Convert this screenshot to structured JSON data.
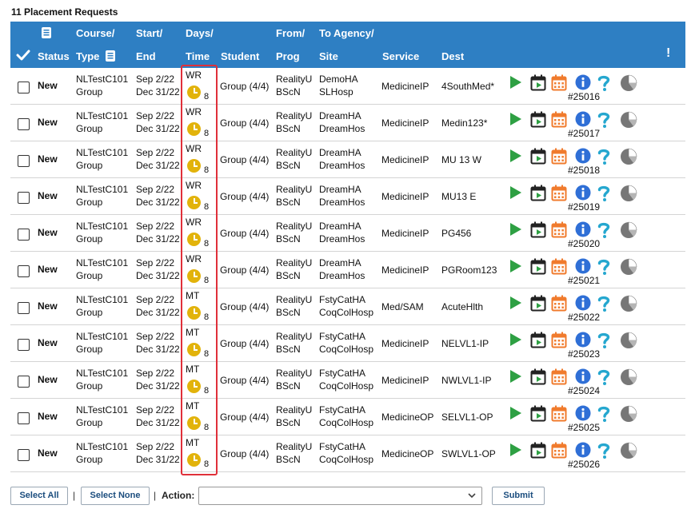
{
  "page_title": "11 Placement Requests",
  "headers": {
    "status": "Status",
    "course_top": "Course/",
    "course_bottom": "Type",
    "start_top": "Start/",
    "start_bottom": "End",
    "days_top": "Days/",
    "days_bottom": "Time",
    "student": "Student",
    "from_top": "From/",
    "from_bottom": "Prog",
    "to_top": "To Agency/",
    "to_bottom": "Site",
    "service": "Service",
    "dest": "Dest",
    "alert": "!"
  },
  "colors": {
    "header_bg": "#2e7fc3",
    "highlight_border": "#e0303a",
    "clock": "#e2b30b",
    "play": "#2ea043",
    "calendar": "#f07b2d",
    "info": "#2f6fd6",
    "help": "#25a7cf",
    "pie": "#777777"
  },
  "icons": [
    "check-icon",
    "document-icon",
    "clock-icon",
    "play-icon",
    "schedule-icon",
    "calendar-icon",
    "info-icon",
    "help-icon",
    "pie-chart-icon"
  ],
  "rows": [
    {
      "status": "New",
      "course": "NLTestC101",
      "type": "Group",
      "start": "Sep 2/22",
      "end": "Dec 31/22",
      "days": "WR",
      "hours": "8",
      "student": "Group (4/4)",
      "from": "RealityU",
      "prog": "BScN",
      "agency": "DemoHA",
      "site": "SLHosp",
      "service": "MedicineIP",
      "dest": "4SouthMed*",
      "req_no": "#25016"
    },
    {
      "status": "New",
      "course": "NLTestC101",
      "type": "Group",
      "start": "Sep 2/22",
      "end": "Dec 31/22",
      "days": "WR",
      "hours": "8",
      "student": "Group (4/4)",
      "from": "RealityU",
      "prog": "BScN",
      "agency": "DreamHA",
      "site": "DreamHos",
      "service": "MedicineIP",
      "dest": "Medin123*",
      "req_no": "#25017"
    },
    {
      "status": "New",
      "course": "NLTestC101",
      "type": "Group",
      "start": "Sep 2/22",
      "end": "Dec 31/22",
      "days": "WR",
      "hours": "8",
      "student": "Group (4/4)",
      "from": "RealityU",
      "prog": "BScN",
      "agency": "DreamHA",
      "site": "DreamHos",
      "service": "MedicineIP",
      "dest": "MU 13 W",
      "req_no": "#25018"
    },
    {
      "status": "New",
      "course": "NLTestC101",
      "type": "Group",
      "start": "Sep 2/22",
      "end": "Dec 31/22",
      "days": "WR",
      "hours": "8",
      "student": "Group (4/4)",
      "from": "RealityU",
      "prog": "BScN",
      "agency": "DreamHA",
      "site": "DreamHos",
      "service": "MedicineIP",
      "dest": "MU13 E",
      "req_no": "#25019"
    },
    {
      "status": "New",
      "course": "NLTestC101",
      "type": "Group",
      "start": "Sep 2/22",
      "end": "Dec 31/22",
      "days": "WR",
      "hours": "8",
      "student": "Group (4/4)",
      "from": "RealityU",
      "prog": "BScN",
      "agency": "DreamHA",
      "site": "DreamHos",
      "service": "MedicineIP",
      "dest": "PG456",
      "req_no": "#25020"
    },
    {
      "status": "New",
      "course": "NLTestC101",
      "type": "Group",
      "start": "Sep 2/22",
      "end": "Dec 31/22",
      "days": "WR",
      "hours": "8",
      "student": "Group (4/4)",
      "from": "RealityU",
      "prog": "BScN",
      "agency": "DreamHA",
      "site": "DreamHos",
      "service": "MedicineIP",
      "dest": "PGRoom123",
      "req_no": "#25021"
    },
    {
      "status": "New",
      "course": "NLTestC101",
      "type": "Group",
      "start": "Sep 2/22",
      "end": "Dec 31/22",
      "days": "MT",
      "hours": "8",
      "student": "Group (4/4)",
      "from": "RealityU",
      "prog": "BScN",
      "agency": "FstyCatHA",
      "site": "CoqColHosp",
      "service": "Med/SAM",
      "dest": "AcuteHlth",
      "req_no": "#25022"
    },
    {
      "status": "New",
      "course": "NLTestC101",
      "type": "Group",
      "start": "Sep 2/22",
      "end": "Dec 31/22",
      "days": "MT",
      "hours": "8",
      "student": "Group (4/4)",
      "from": "RealityU",
      "prog": "BScN",
      "agency": "FstyCatHA",
      "site": "CoqColHosp",
      "service": "MedicineIP",
      "dest": "NELVL1-IP",
      "req_no": "#25023"
    },
    {
      "status": "New",
      "course": "NLTestC101",
      "type": "Group",
      "start": "Sep 2/22",
      "end": "Dec 31/22",
      "days": "MT",
      "hours": "8",
      "student": "Group (4/4)",
      "from": "RealityU",
      "prog": "BScN",
      "agency": "FstyCatHA",
      "site": "CoqColHosp",
      "service": "MedicineIP",
      "dest": "NWLVL1-IP",
      "req_no": "#25024"
    },
    {
      "status": "New",
      "course": "NLTestC101",
      "type": "Group",
      "start": "Sep 2/22",
      "end": "Dec 31/22",
      "days": "MT",
      "hours": "8",
      "student": "Group (4/4)",
      "from": "RealityU",
      "prog": "BScN",
      "agency": "FstyCatHA",
      "site": "CoqColHosp",
      "service": "MedicineOP",
      "dest": "SELVL1-OP",
      "req_no": "#25025"
    },
    {
      "status": "New",
      "course": "NLTestC101",
      "type": "Group",
      "start": "Sep 2/22",
      "end": "Dec 31/22",
      "days": "MT",
      "hours": "8",
      "student": "Group (4/4)",
      "from": "RealityU",
      "prog": "BScN",
      "agency": "FstyCatHA",
      "site": "CoqColHosp",
      "service": "MedicineOP",
      "dest": "SWLVL1-OP",
      "req_no": "#25026"
    }
  ],
  "footer": {
    "select_all": "Select All",
    "select_none": "Select None",
    "separator": "|",
    "action_label": "Action:",
    "action_value": "",
    "submit": "Submit"
  }
}
